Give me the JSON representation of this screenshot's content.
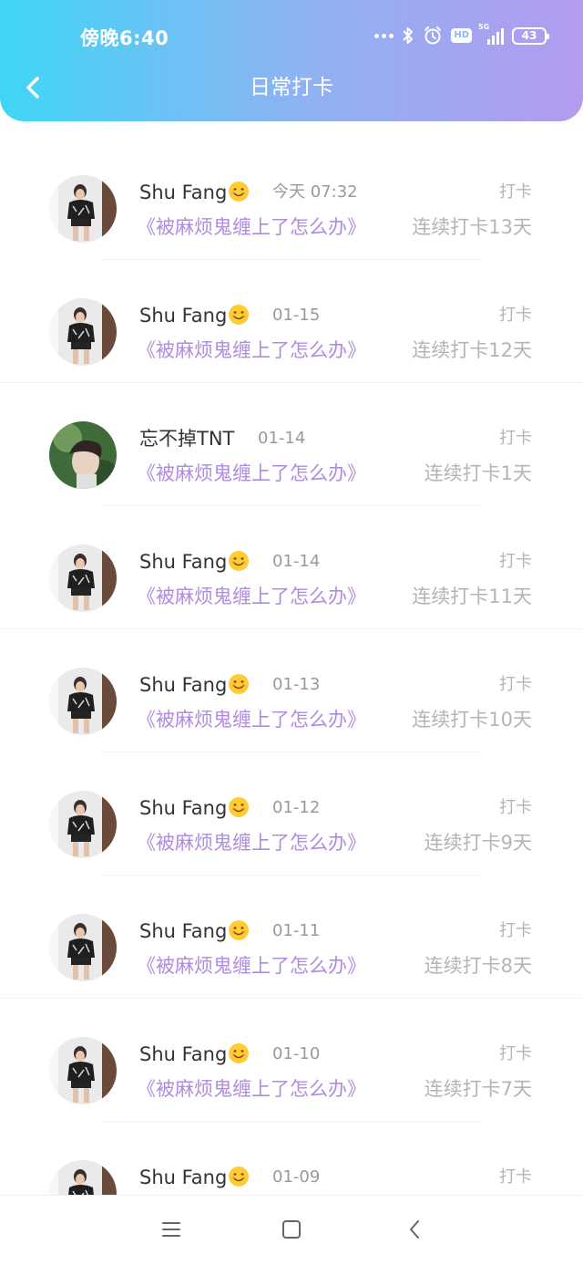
{
  "status_bar": {
    "time": "傍晚6:40",
    "network": "5G",
    "battery": "43",
    "hd": "HD",
    "icons": [
      "more-dots-icon",
      "bluetooth-icon",
      "alarm-icon",
      "hd-icon",
      "signal-icon",
      "battery-icon"
    ]
  },
  "header": {
    "title": "日常打卡",
    "back_icon": "chevron-left-icon",
    "gradient": [
      "#3fd6f5",
      "#b39bee"
    ]
  },
  "colors": {
    "accent_purple": "#b08be0",
    "muted_gray": "#b4b4b4",
    "name_text": "#333333"
  },
  "checkins": [
    {
      "user": "Shu Fang",
      "emoji": "smile",
      "date": "今天 07:32",
      "book": "《被麻烦鬼缠上了怎么办》",
      "action": "打卡",
      "streak": "连续打卡13天"
    },
    {
      "user": "Shu Fang",
      "emoji": "smile",
      "date": "01-15",
      "book": "《被麻烦鬼缠上了怎么办》",
      "action": "打卡",
      "streak": "连续打卡12天"
    },
    {
      "user": "忘不掉TNT",
      "emoji": "",
      "date": "01-14",
      "book": "《被麻烦鬼缠上了怎么办》",
      "action": "打卡",
      "streak": "连续打卡1天"
    },
    {
      "user": "Shu Fang",
      "emoji": "smile",
      "date": "01-14",
      "book": "《被麻烦鬼缠上了怎么办》",
      "action": "打卡",
      "streak": "连续打卡11天"
    },
    {
      "user": "Shu Fang",
      "emoji": "smile",
      "date": "01-13",
      "book": "《被麻烦鬼缠上了怎么办》",
      "action": "打卡",
      "streak": "连续打卡10天"
    },
    {
      "user": "Shu Fang",
      "emoji": "smile",
      "date": "01-12",
      "book": "《被麻烦鬼缠上了怎么办》",
      "action": "打卡",
      "streak": "连续打卡9天"
    },
    {
      "user": "Shu Fang",
      "emoji": "smile",
      "date": "01-11",
      "book": "《被麻烦鬼缠上了怎么办》",
      "action": "打卡",
      "streak": "连续打卡8天"
    },
    {
      "user": "Shu Fang",
      "emoji": "smile",
      "date": "01-10",
      "book": "《被麻烦鬼缠上了怎么办》",
      "action": "打卡",
      "streak": "连续打卡7天"
    },
    {
      "user": "Shu Fang",
      "emoji": "smile",
      "date": "01-09",
      "book": "",
      "action": "打卡",
      "streak": ""
    }
  ],
  "nav_bar": {
    "icons": [
      "menu-icon",
      "home-square-icon",
      "back-triangle-icon"
    ]
  }
}
